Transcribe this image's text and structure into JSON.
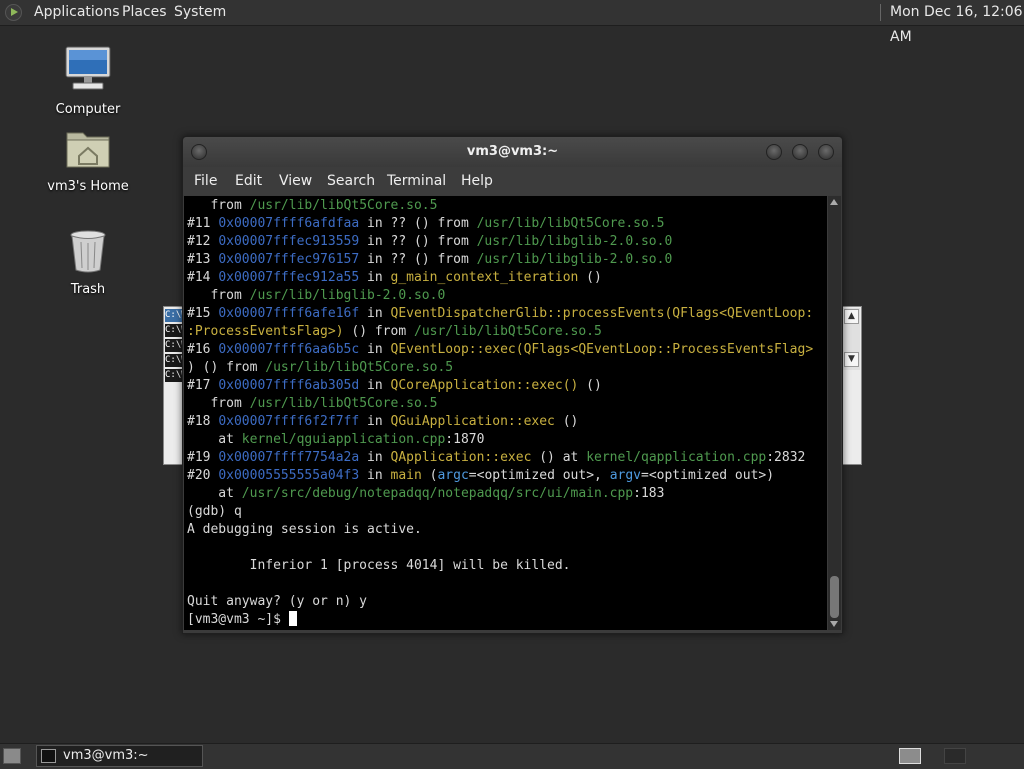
{
  "top_panel": {
    "menus": [
      "Applications",
      "Places",
      "System"
    ],
    "clock": "Mon Dec 16, 12:06 AM"
  },
  "desktop_icons": {
    "computer": "Computer",
    "home": "vm3's Home",
    "trash": "Trash"
  },
  "background_window": {
    "line_prefix": "C:\\W"
  },
  "terminal": {
    "title": "vm3@vm3:~",
    "menu": [
      "File",
      "Edit",
      "View",
      "Search",
      "Terminal",
      "Help"
    ],
    "lines": [
      [
        {
          "t": "   from "
        },
        {
          "t": "/usr/lib/libQt5Core.so.5",
          "c": "path"
        }
      ],
      [
        {
          "t": "#11 "
        },
        {
          "t": "0x00007ffff6afdfaa",
          "c": "addr"
        },
        {
          "t": " in ?? () from "
        },
        {
          "t": "/usr/lib/libQt5Core.so.5",
          "c": "path"
        }
      ],
      [
        {
          "t": "#12 "
        },
        {
          "t": "0x00007fffec913559",
          "c": "addr"
        },
        {
          "t": " in ?? () from "
        },
        {
          "t": "/usr/lib/libglib-2.0.so.0",
          "c": "path"
        }
      ],
      [
        {
          "t": "#13 "
        },
        {
          "t": "0x00007fffec976157",
          "c": "addr"
        },
        {
          "t": " in ?? () from "
        },
        {
          "t": "/usr/lib/libglib-2.0.so.0",
          "c": "path"
        }
      ],
      [
        {
          "t": "#14 "
        },
        {
          "t": "0x00007fffec912a55",
          "c": "addr"
        },
        {
          "t": " in "
        },
        {
          "t": "g_main_context_iteration",
          "c": "func"
        },
        {
          "t": " ()"
        }
      ],
      [
        {
          "t": "   from "
        },
        {
          "t": "/usr/lib/libglib-2.0.so.0",
          "c": "path"
        }
      ],
      [
        {
          "t": "#15 "
        },
        {
          "t": "0x00007ffff6afe16f",
          "c": "addr"
        },
        {
          "t": " in "
        },
        {
          "t": "QEventDispatcherGlib::processEvents(QFlags<QEventLoop:",
          "c": "func"
        }
      ],
      [
        {
          "t": ":ProcessEventsFlag>)",
          "c": "func"
        },
        {
          "t": " () from "
        },
        {
          "t": "/usr/lib/libQt5Core.so.5",
          "c": "path"
        }
      ],
      [
        {
          "t": "#16 "
        },
        {
          "t": "0x00007ffff6aa6b5c",
          "c": "addr"
        },
        {
          "t": " in "
        },
        {
          "t": "QEventLoop::exec(QFlags<QEventLoop::ProcessEventsFlag>",
          "c": "func"
        }
      ],
      [
        {
          "t": ") () from "
        },
        {
          "t": "/usr/lib/libQt5Core.so.5",
          "c": "path"
        }
      ],
      [
        {
          "t": "#17 "
        },
        {
          "t": "0x00007ffff6ab305d",
          "c": "addr"
        },
        {
          "t": " in "
        },
        {
          "t": "QCoreApplication::exec()",
          "c": "func"
        },
        {
          "t": " ()"
        }
      ],
      [
        {
          "t": "   from "
        },
        {
          "t": "/usr/lib/libQt5Core.so.5",
          "c": "path"
        }
      ],
      [
        {
          "t": "#18 "
        },
        {
          "t": "0x00007ffff6f2f7ff",
          "c": "addr"
        },
        {
          "t": " in "
        },
        {
          "t": "QGuiApplication::exec",
          "c": "func"
        },
        {
          "t": " ()"
        }
      ],
      [
        {
          "t": "    at "
        },
        {
          "t": "kernel/qguiapplication.cpp",
          "c": "path"
        },
        {
          "t": ":1870"
        }
      ],
      [
        {
          "t": "#19 "
        },
        {
          "t": "0x00007ffff7754a2a",
          "c": "addr"
        },
        {
          "t": " in "
        },
        {
          "t": "QApplication::exec",
          "c": "func"
        },
        {
          "t": " () at "
        },
        {
          "t": "kernel/qapplication.cpp",
          "c": "path"
        },
        {
          "t": ":2832"
        }
      ],
      [
        {
          "t": "#20 "
        },
        {
          "t": "0x00005555555a04f3",
          "c": "addr"
        },
        {
          "t": " in "
        },
        {
          "t": "main",
          "c": "func"
        },
        {
          "t": " ("
        },
        {
          "t": "argc",
          "c": "param"
        },
        {
          "t": "=<optimized out>, "
        },
        {
          "t": "argv",
          "c": "param"
        },
        {
          "t": "=<optimized out>)"
        }
      ],
      [
        {
          "t": "    at "
        },
        {
          "t": "/usr/src/debug/notepadqq/notepadqq/src/ui/main.cpp",
          "c": "path"
        },
        {
          "t": ":183"
        }
      ],
      [
        {
          "t": "(gdb) q"
        }
      ],
      [
        {
          "t": "A debugging session is active."
        }
      ],
      [
        {
          "t": ""
        }
      ],
      [
        {
          "t": "        Inferior 1 [process 4014] will be killed."
        }
      ],
      [
        {
          "t": ""
        }
      ],
      [
        {
          "t": "Quit anyway? (y or n) y"
        }
      ],
      [
        {
          "t": "[vm3@vm3 ~]$ "
        }
      ]
    ]
  },
  "taskbar": {
    "task_label": "vm3@vm3:~"
  },
  "colors": {
    "addr": "#3d6cc4",
    "path": "#4f9a4f",
    "func": "#c8b040",
    "param": "#4f9adf"
  }
}
